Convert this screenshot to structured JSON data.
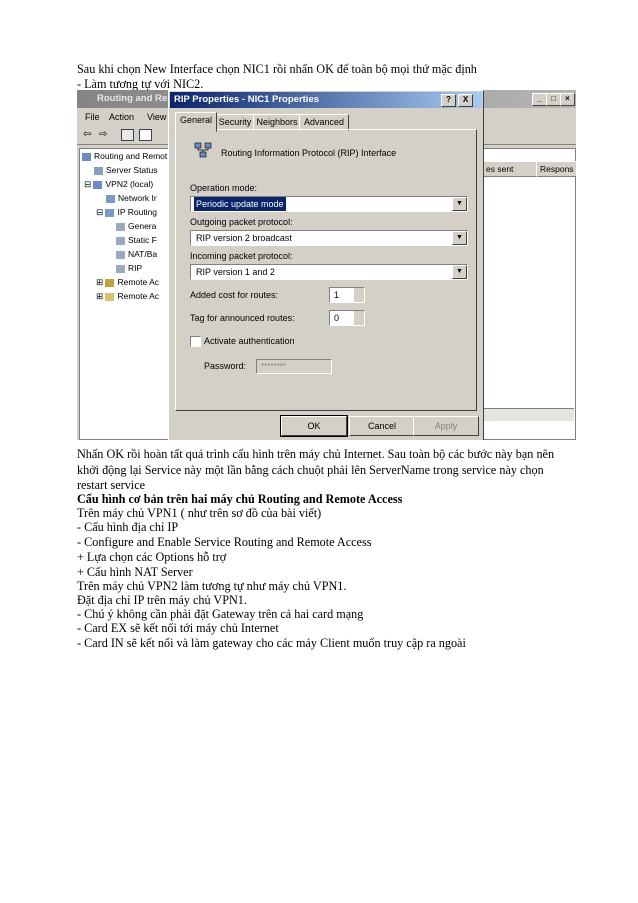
{
  "text": {
    "l1": "Sau khi chọn New Interface chọn NIC1 rồi nhấn OK để toàn bộ mọi thứ mặc định",
    "l2": "- Làm tương tự với NIC2.",
    "l3": "Nhấn OK rồi hoàn tất quá trình cấu hình trên máy chủ Internet. Sau toàn bộ các bước này bạn nên",
    "l4": "khởi động lại Service này một lần bằng cách chuột phải lên ServerName trong service này chọn",
    "l5": "restart service",
    "l6": "Cấu hình cơ bản trên hai máy chủ Routing and Remote Access",
    "l7": "Trên máy chủ VPN1 ( như trên sơ đồ của bài viết)",
    "l8": "- Cấu hình địa chỉ IP",
    "l9": "- Configure and Enable Service Routing and Remote Access",
    "l10": "+ Lựa chọn các Options hỗ trợ",
    "l11": "+ Cấu hình NAT Server",
    "l12": "Trên máy chủ VPN2 làm tương tự như máy chủ VPN1.",
    "l13": "Đặt địa chỉ IP trên máy chủ VPN1.",
    "l14": "- Chú ý không cần phải đặt Gateway trên cả hai card mạng",
    "l15": "- Card EX sẽ kết nối tới máy chủ Internet",
    "l16": "- Card IN sẽ kết nối và làm gateway cho các máy Client muốn truy cập ra ngoài"
  },
  "bg_window": {
    "title": "Routing and Rem",
    "menu": [
      "File",
      "Action",
      "View"
    ],
    "tree": [
      "Routing and Remot",
      "Server Status",
      "VPN2 (local)",
      "Network Ir",
      "IP Routing",
      "Genera",
      "Static F",
      "NAT/Ba",
      "RIP",
      "Remote Ac",
      "Remote Ac"
    ],
    "columns": [
      "es sent",
      "Respons"
    ]
  },
  "dialog": {
    "title": "RIP Properties - NIC1 Properties",
    "title_buttons": [
      "?",
      "X"
    ],
    "tabs": [
      "General",
      "Security",
      "Neighbors",
      "Advanced"
    ],
    "heading": "Routing Information Protocol (RIP) Interface",
    "operation_mode_label": "Operation mode:",
    "operation_mode_value": "Periodic update mode",
    "outgoing_label": "Outgoing packet protocol:",
    "outgoing_value": "RIP version 2 broadcast",
    "incoming_label": "Incoming packet protocol:",
    "incoming_value": "RIP version 1 and 2",
    "added_cost_label": "Added cost for routes:",
    "added_cost_value": "1",
    "tag_label": "Tag for announced routes:",
    "tag_value": "0",
    "activate_auth_label": "Activate authentication",
    "password_label": "Password:",
    "password_value": "********",
    "ok": "OK",
    "cancel": "Cancel",
    "apply": "Apply"
  }
}
